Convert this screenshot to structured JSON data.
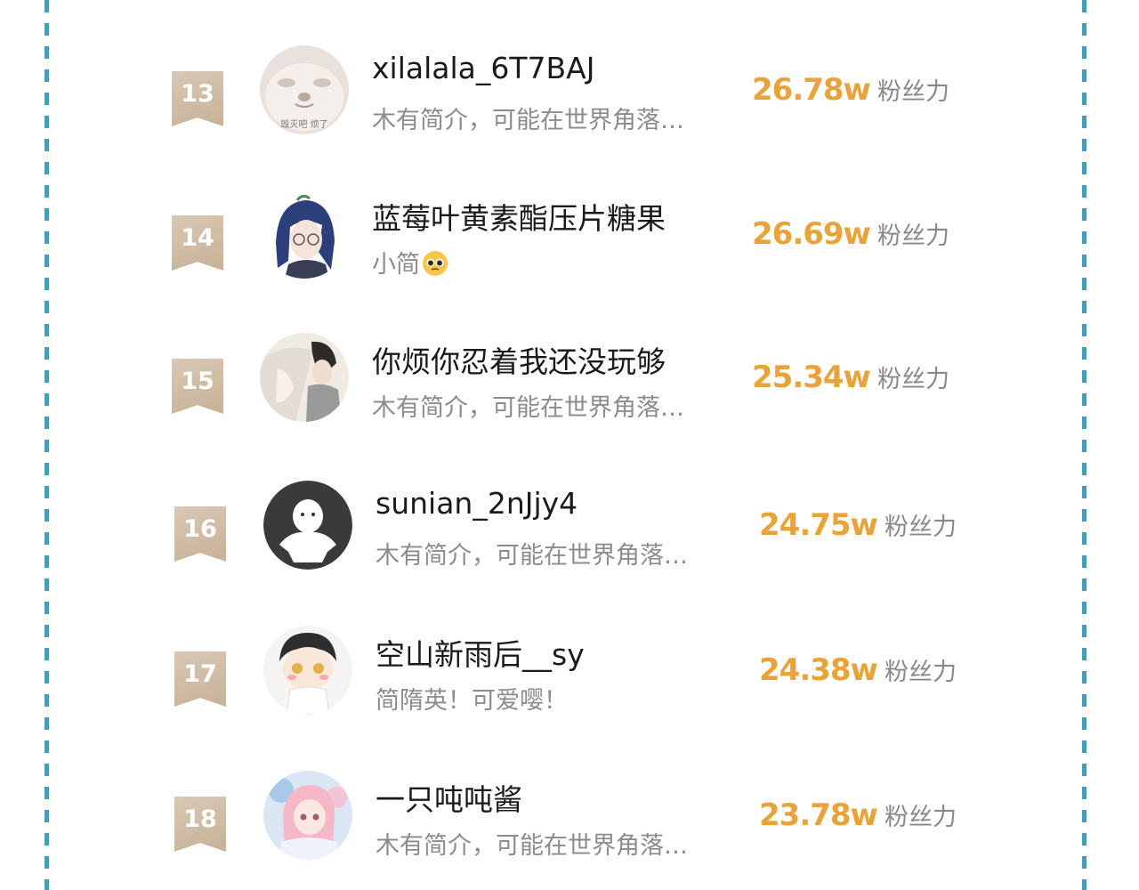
{
  "rankings": [
    {
      "rank": "13",
      "name": "xilalala_6T7BAJ",
      "bio": "木有简介，可能在世界角落…",
      "value": "26.78w",
      "unit": "粉丝力",
      "avatar_caption": "毁灭吧 烦了"
    },
    {
      "rank": "14",
      "name": "蓝莓叶黄素酯压片糖果",
      "bio": "小简",
      "bio_emoji": "pleading-face-emoji",
      "value": "26.69w",
      "unit": "粉丝力"
    },
    {
      "rank": "15",
      "name": "你烦你忍着我还没玩够",
      "bio": "木有简介，可能在世界角落…",
      "value": "25.34w",
      "unit": "粉丝力"
    },
    {
      "rank": "16",
      "name": "sunian_2nJjy4",
      "bio": "木有简介，可能在世界角落…",
      "value": "24.75w",
      "unit": "粉丝力"
    },
    {
      "rank": "17",
      "name": "空山新雨后__sy",
      "bio": "简隋英！可爱嘤！",
      "value": "24.38w",
      "unit": "粉丝力"
    },
    {
      "rank": "18",
      "name": "一只吨吨酱",
      "bio": "木有简介，可能在世界角落…",
      "value": "23.78w",
      "unit": "粉丝力"
    }
  ],
  "colors": {
    "accent": "#e8a43a",
    "rank_badge": "#c7b197",
    "dashed_border": "#4a9bb5"
  }
}
